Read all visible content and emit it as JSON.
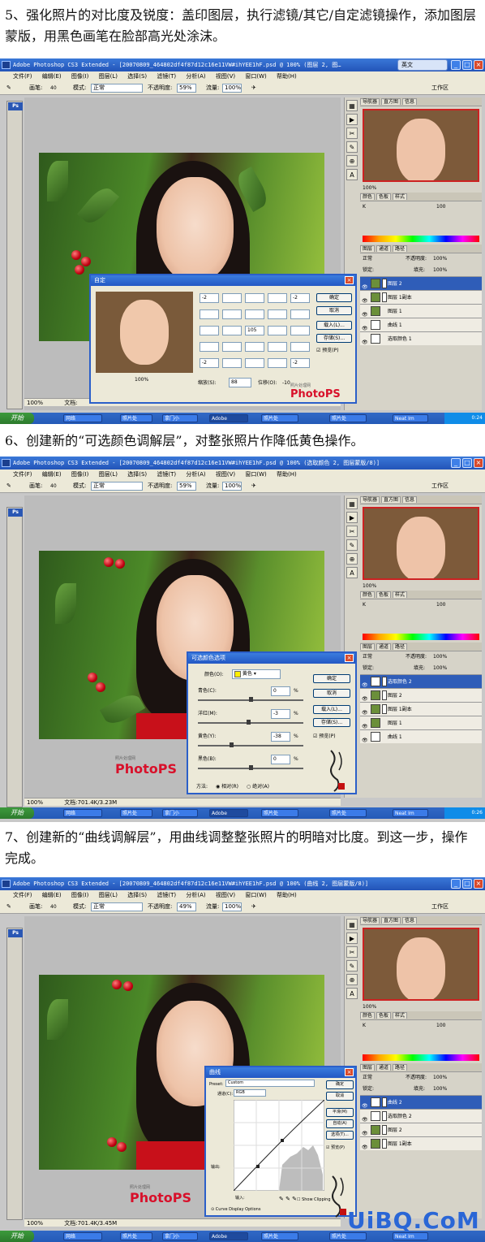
{
  "steps": [
    {
      "caption": "5、强化照片的对比度及锐度：盖印图层，执行滤镜/其它/自定滤镜操作，添加图层蒙版，用黑色画笔在脸部高光处涂沫。",
      "window_title": "Adobe Photoshop CS3 Extended - [20070809_464802df4f87d12c16e11VW#ihYEE1hF.psd @ 100% (图层 2, 图…",
      "status_zoom": "100%",
      "status_doc": "文档:",
      "options": {
        "brush_label": "画笔:",
        "brush_size": "40",
        "mode_label": "模式:",
        "mode_value": "正常",
        "opacity_label": "不透明度:",
        "opacity_value": "59%",
        "flow_label": "流量:",
        "flow_value": "100%"
      },
      "dialog": {
        "title": "自定",
        "matrix_visible": [
          "-2",
          "",
          "",
          "",
          "-2",
          "",
          "",
          "",
          "",
          "",
          "",
          "",
          "105",
          "",
          "",
          "",
          "",
          "",
          "",
          "",
          "-2",
          "",
          "",
          "",
          "-2"
        ],
        "zoom": "100%",
        "scale_label": "缩放(S):",
        "scale_value": "88",
        "offset_label": "位移(O):",
        "offset_value": "-10",
        "buttons": [
          "确定",
          "取消",
          "载入(L)...",
          "存储(S)..."
        ],
        "preview": "预览(P)"
      },
      "ime": "英文",
      "layers": {
        "blend": "正常",
        "opacity_label": "不透明度:",
        "opacity": "100%",
        "fill_label": "填充:",
        "fill": "100%",
        "rows": [
          "图层 2",
          "图层 1副本",
          "图层 1",
          "曲线 1",
          "选取颜色 1"
        ],
        "selected": 0
      },
      "nav_zoom": "100%",
      "color_k": "100",
      "time": "0:24"
    },
    {
      "caption": "6、创建新的“可选颜色调解层”，对整张照片作降低黄色操作。",
      "window_title": "Adobe Photoshop CS3 Extended - [20070809_464802df4f87d12c16e11VW#ihYEE1hF.psd @ 100% (选取颜色 2, 图层蒙版/8)]",
      "status_zoom": "100%",
      "status_doc": "文档:701.4K/3.23M",
      "options": {
        "brush_label": "画笔:",
        "brush_size": "40",
        "mode_label": "模式:",
        "mode_value": "正常",
        "opacity_label": "不透明度:",
        "opacity_value": "59%",
        "flow_label": "流量:",
        "flow_value": "100%"
      },
      "dialog": {
        "title": "可选颜色选项",
        "color_label": "颜色(O):",
        "color_value": "黄色",
        "channels": [
          {
            "label": "青色(C):",
            "value": "0",
            "pos": 0.5
          },
          {
            "label": "洋红(M):",
            "value": "-3",
            "pos": 0.48
          },
          {
            "label": "黄色(Y):",
            "value": "-38",
            "pos": 0.31
          },
          {
            "label": "黑色(B):",
            "value": "0",
            "pos": 0.5
          }
        ],
        "pct": "%",
        "method_label": "方法:",
        "method_relative": "相对(R)",
        "method_absolute": "绝对(A)",
        "buttons": [
          "确定",
          "取消",
          "载入(L)...",
          "存储(S)..."
        ],
        "preview": "预览(P)"
      },
      "layers": {
        "blend": "正常",
        "opacity_label": "不透明度:",
        "opacity": "100%",
        "fill_label": "填充:",
        "fill": "100%",
        "rows": [
          "选取颜色 2",
          "图层 2",
          "图层 1副本",
          "图层 1",
          "曲线 1"
        ],
        "selected": 0
      },
      "nav_zoom": "100%",
      "color_k": "100",
      "time": "0:26"
    },
    {
      "caption": "7、创建新的“曲线调解层”，用曲线调整整张照片的明暗对比度。到这一步，操作完成。",
      "window_title": "Adobe Photoshop CS3 Extended - [20070809_464802df4f87d12c16e11VW#ihYEE1hF.psd @ 100% (曲线 2, 图层蒙版/8)]",
      "status_zoom": "100%",
      "status_doc": "文档:701.4K/3.45M",
      "options": {
        "brush_label": "画笔:",
        "brush_size": "40",
        "mode_label": "模式:",
        "mode_value": "正常",
        "opacity_label": "不透明度:",
        "opacity_value": "49%",
        "flow_label": "流量:",
        "flow_value": "100%"
      },
      "dialog": {
        "title": "曲线",
        "preset_label": "Preset:",
        "preset_value": "Custom",
        "channel_label": "通道(C):",
        "channel_value": "RGB",
        "output_label": "输出:",
        "input_label": "输入:",
        "show_clipping": "Show Clipping",
        "curve_display": "Curve Display Options",
        "buttons": [
          "确定",
          "取消",
          "平滑(M)",
          "自动(A)",
          "选项(T)..."
        ],
        "preview": "预览(P)"
      },
      "layers": {
        "blend": "正常",
        "opacity_label": "不透明度:",
        "opacity": "100%",
        "fill_label": "填充:",
        "fill": "100%",
        "rows": [
          "曲线 2",
          "选取颜色 2",
          "图层 2",
          "图层 1副本"
        ],
        "selected": 0
      },
      "nav_zoom": "100%",
      "color_k": "100",
      "time": ""
    }
  ],
  "menu": [
    "文件(F)",
    "编辑(E)",
    "图像(I)",
    "图层(L)",
    "选择(S)",
    "滤镜(T)",
    "分析(A)",
    "视图(V)",
    "窗口(W)",
    "帮助(H)"
  ],
  "panel_tabs_nav": [
    "导航器",
    "直方图",
    "信息"
  ],
  "panel_tabs_color": [
    "颜色",
    "色板",
    "样式"
  ],
  "panel_tabs_layers": [
    "图层",
    "通道",
    "路径"
  ],
  "lock_label": "锁定:",
  "workspace": "工作区",
  "start_label": "开始",
  "taskbar_items": [
    "网络",
    "照片处",
    "拿门小",
    "Adobe",
    "照片处",
    "照片处",
    "Neat Im"
  ],
  "watermark_top": "照片处理网",
  "watermark_main": "PhotoPS",
  "footer_logo": "UiBQ.CoM",
  "colors": {
    "xp_blue": "#2358c4",
    "panel": "#d6d3c8",
    "selected_layer": "#2f5db8",
    "watermark_red": "#d8102a"
  }
}
